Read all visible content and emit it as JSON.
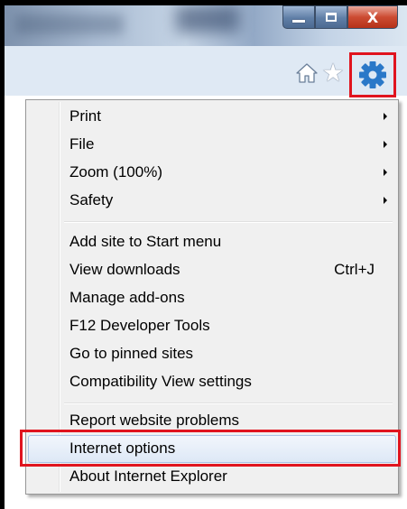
{
  "window": {
    "minimize_icon": "minimize-icon",
    "maximize_icon": "restore-icon",
    "close_label": "X"
  },
  "toolbar": {
    "icons": [
      "home-icon",
      "star-icon",
      "gear-icon"
    ],
    "accent": "#2a78c8"
  },
  "menu": {
    "items": [
      {
        "label": "Print",
        "submenu": true
      },
      {
        "label": "File",
        "submenu": true
      },
      {
        "label": "Zoom (100%)",
        "submenu": true
      },
      {
        "label": "Safety",
        "submenu": true
      },
      {
        "label": "Add site to Start menu"
      },
      {
        "label": "View downloads",
        "shortcut": "Ctrl+J"
      },
      {
        "label": "Manage add-ons"
      },
      {
        "label": "F12 Developer Tools"
      },
      {
        "label": "Go to pinned sites"
      },
      {
        "label": "Compatibility View settings"
      },
      {
        "label": "Report website problems"
      },
      {
        "label": "Internet options",
        "highlighted": true
      },
      {
        "label": "About Internet Explorer"
      }
    ]
  },
  "highlight_color": "#e0141e"
}
